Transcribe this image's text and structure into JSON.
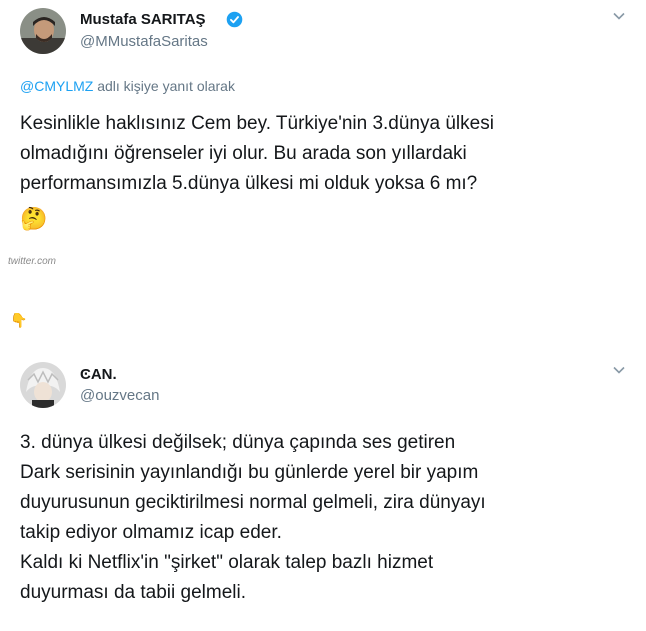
{
  "tweet1": {
    "name": "Mustafa SARITAŞ",
    "handle": "@MMustafaSaritas",
    "reply_mention": "@CMYLMZ",
    "reply_suffix": " adlı kişiye yanıt olarak",
    "text": "Kesinlikle haklısınız Cem bey. Türkiye'nin 3.dünya ülkesi\nolmadığını öğrenseler iyi olur. Bu arada son yıllardaki\nperformansımızla 5.dünya ülkesi mi olduk yoksa 6 mı?",
    "emoji": "🤔",
    "verified": true,
    "icons": {
      "verified": "verified-badge-icon",
      "menu": "chevron-down-icon"
    }
  },
  "watermark": "twitter.com",
  "pointer_emoji": "👇",
  "tweet2": {
    "name": "ϾAN.",
    "handle": "@ouzvecan",
    "text": "3. dünya ülkesi değilsek; dünya çapında ses getiren\nDark serisinin yayınlandığı bu günlerde yerel bir yapım\nduyurusunun geciktirilmesi normal gelmeli, zira dünyayı\ntakip ediyor olmamız icap eder.\nKaldı ki Netflix'in \"şirket\" olarak talep bazlı hizmet\nduyurması da tabii gelmeli.",
    "icons": {
      "menu": "chevron-down-icon"
    }
  },
  "colors": {
    "link": "#1da1f2",
    "secondary": "#657786",
    "text": "#14171a"
  }
}
